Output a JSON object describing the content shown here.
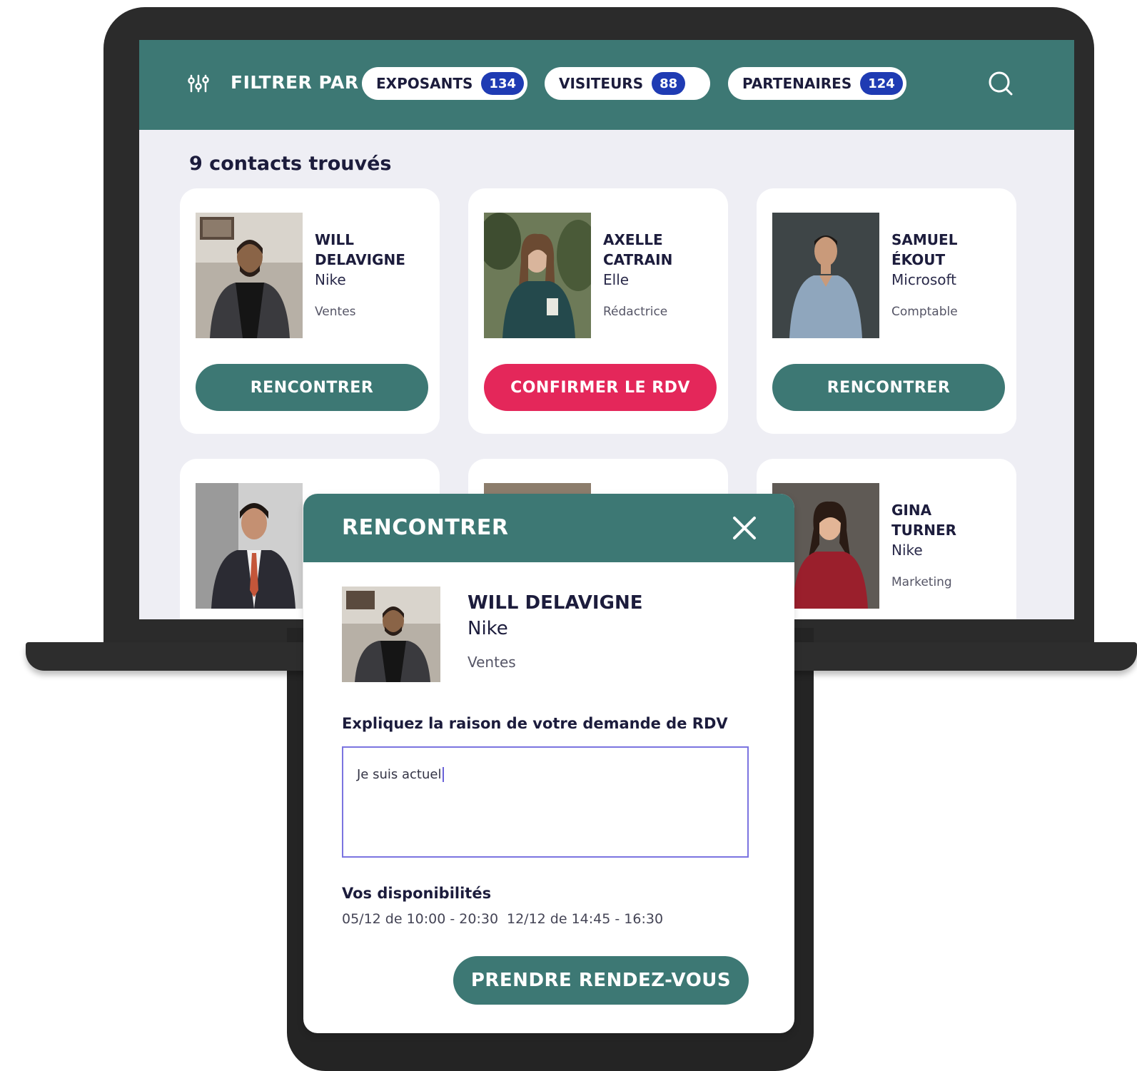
{
  "header": {
    "filter_label": "FILTRER PAR",
    "filters": [
      {
        "label": "EXPOSANTS",
        "count": "134"
      },
      {
        "label": "VISITEURS",
        "count": "88"
      },
      {
        "label": "PARTENAIRES",
        "count": "124"
      }
    ]
  },
  "results": {
    "count_text": "9 contacts trouvés"
  },
  "contacts": [
    {
      "first": "WILL",
      "last": "DELAVIGNE",
      "company": "Nike",
      "role": "Ventes",
      "button": "RENCONTRER"
    },
    {
      "first": "AXELLE",
      "last": "CATRAIN",
      "company": "Elle",
      "role": "Rédactrice",
      "button": "CONFIRMER LE RDV"
    },
    {
      "first": "SAMUEL",
      "last": "ÉKOUT",
      "company": "Microsoft",
      "role": "Comptable",
      "button": "RENCONTRER"
    },
    {
      "first": "GINA",
      "last": "TURNER",
      "company": "Nike",
      "role": "Marketing"
    }
  ],
  "modal": {
    "title": "RENCONTRER",
    "name": "WILL DELAVIGNE",
    "company": "Nike",
    "role": "Ventes",
    "reason_label": "Expliquez la raison de votre demande de RDV",
    "reason_value": "Je suis actuel",
    "availability_label": "Vos disponibilités",
    "slots": [
      "05/12 de 10:00 - 20:30",
      "12/12 de 14:45 - 16:30"
    ],
    "submit_label": "PRENDRE RENDEZ-VOUS"
  },
  "colors": {
    "primary": "#3d7874",
    "accent": "#e4275a",
    "badge": "#1f3bb3",
    "text_dark": "#1c1c3c",
    "input_border": "#7b74e0"
  }
}
